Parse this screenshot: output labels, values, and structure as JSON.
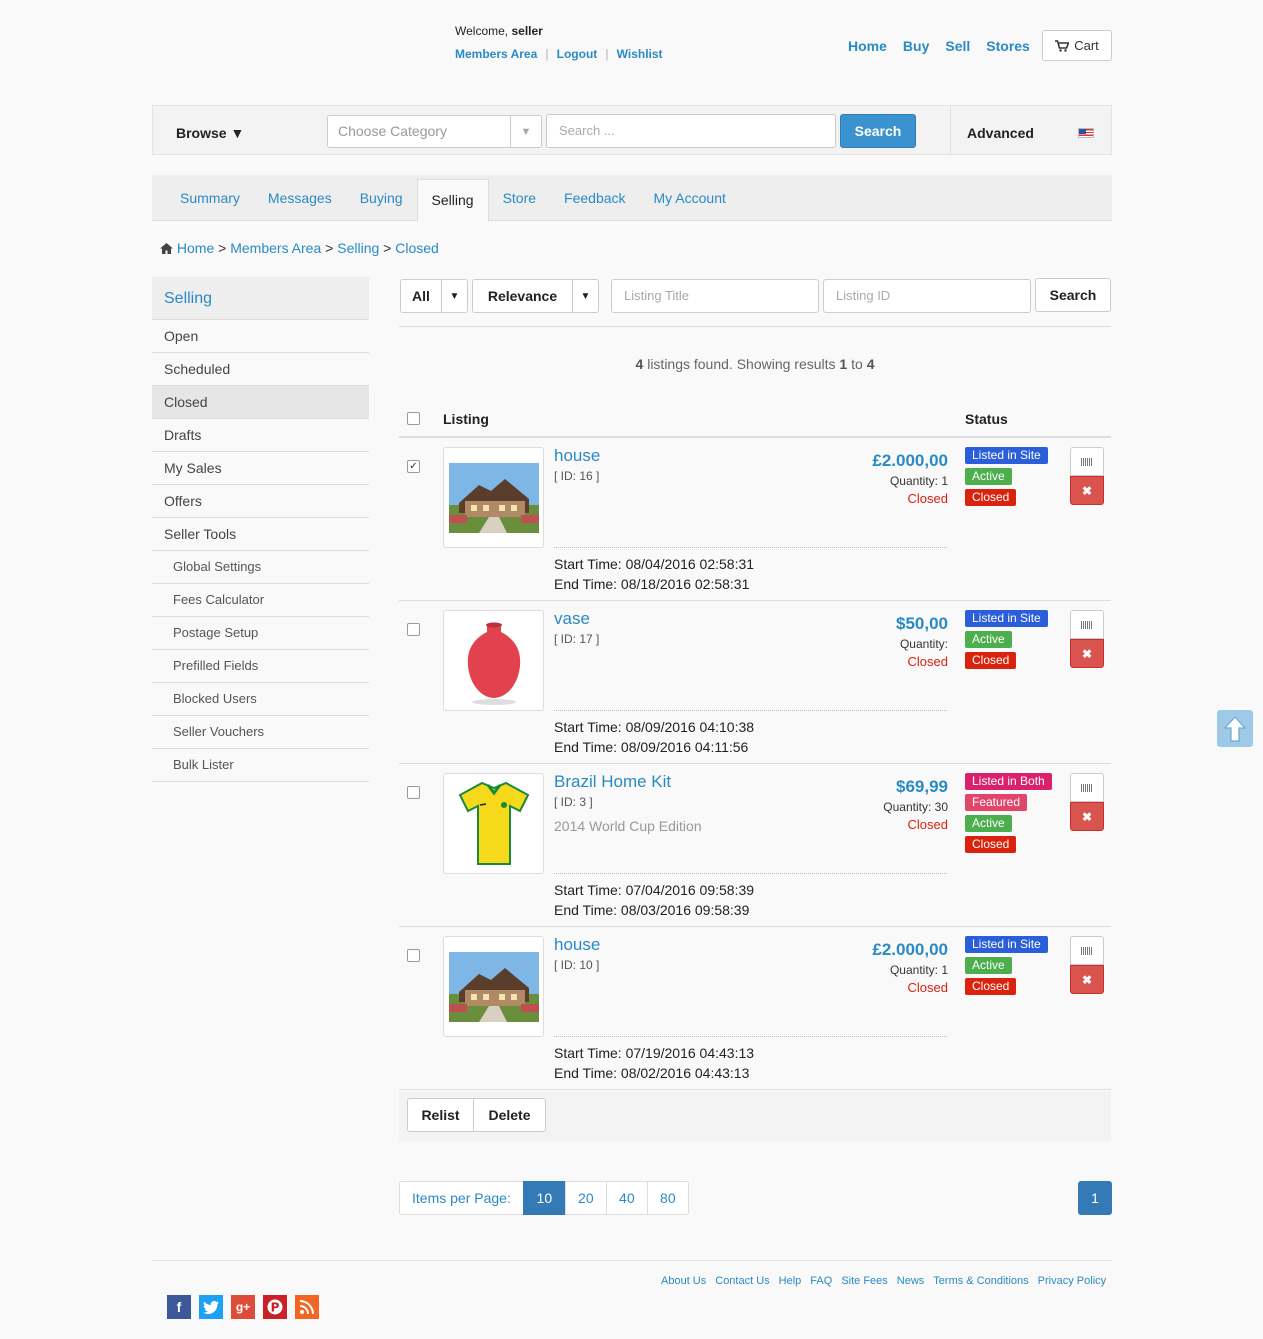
{
  "header": {
    "welcome_prefix": "Welcome,",
    "username": "seller",
    "links": [
      "Members Area",
      "Logout",
      "Wishlist"
    ],
    "nav": [
      "Home",
      "Buy",
      "Sell",
      "Stores"
    ],
    "cart_label": "Cart"
  },
  "searchbar": {
    "browse_label": "Browse ▼",
    "category_placeholder": "Choose Category",
    "search_placeholder": "Search ...",
    "search_button": "Search",
    "advanced_label": "Advanced"
  },
  "tabs": [
    "Summary",
    "Messages",
    "Buying",
    "Selling",
    "Store",
    "Feedback",
    "My Account"
  ],
  "active_tab": "Selling",
  "breadcrumb": [
    "Home",
    "Members Area",
    "Selling",
    "Closed"
  ],
  "sidebar": {
    "title": "Selling",
    "items": [
      "Open",
      "Scheduled",
      "Closed",
      "Drafts",
      "My Sales",
      "Offers",
      "Seller Tools"
    ],
    "sub_items": [
      "Global Settings",
      "Fees Calculator",
      "Postage Setup",
      "Prefilled Fields",
      "Blocked Users",
      "Seller Vouchers",
      "Bulk Lister"
    ],
    "active": "Closed"
  },
  "filters": {
    "filter_label": "All",
    "sort_label": "Relevance",
    "title_placeholder": "Listing Title",
    "id_placeholder": "Listing ID",
    "search_button": "Search"
  },
  "results": {
    "count": "4",
    "text_a": "listings found. Showing results",
    "from": "1",
    "to_word": "to",
    "to": "4"
  },
  "table": {
    "col_listing": "Listing",
    "col_status": "Status"
  },
  "listings": [
    {
      "title": "house",
      "id": "[ ID: 16 ]",
      "subtitle": "",
      "price": "£2.000,00",
      "quantity": "Quantity: 1",
      "state": "Closed",
      "start": "Start Time: 08/04/2016 02:58:31",
      "end": "End Time: 08/18/2016 02:58:31",
      "badges": [
        "Listed in Site",
        "Active",
        "Closed"
      ],
      "checked": true,
      "image": "house"
    },
    {
      "title": "vase",
      "id": "[ ID: 17 ]",
      "subtitle": "",
      "price": "$50,00",
      "quantity": "Quantity:",
      "state": "Closed",
      "start": "Start Time: 08/09/2016 04:10:38",
      "end": "End Time: 08/09/2016 04:11:56",
      "badges": [
        "Listed in Site",
        "Active",
        "Closed"
      ],
      "checked": false,
      "image": "vase"
    },
    {
      "title": "Brazil Home Kit",
      "id": "[ ID: 3 ]",
      "subtitle": "2014 World Cup Edition",
      "price": "$69,99",
      "quantity": "Quantity: 30",
      "state": "Closed",
      "start": "Start Time: 07/04/2016 09:58:39",
      "end": "End Time: 08/03/2016 09:58:39",
      "badges": [
        "Listed in Both",
        "Featured",
        "Active",
        "Closed"
      ],
      "checked": false,
      "image": "shirt"
    },
    {
      "title": "house",
      "id": "[ ID: 10 ]",
      "subtitle": "",
      "price": "£2.000,00",
      "quantity": "Quantity: 1",
      "state": "Closed",
      "start": "Start Time: 07/19/2016 04:43:13",
      "end": "End Time: 08/02/2016 04:43:13",
      "badges": [
        "Listed in Site",
        "Active",
        "Closed"
      ],
      "checked": false,
      "image": "house"
    }
  ],
  "bulk_actions": [
    "Relist",
    "Delete"
  ],
  "pagination": {
    "items_label": "Items per Page:",
    "sizes": [
      "10",
      "20",
      "40",
      "80"
    ],
    "active_size": "10",
    "current_page": "1"
  },
  "footer": {
    "links": [
      "About Us",
      "Contact Us",
      "Help",
      "FAQ",
      "Site Fees",
      "News",
      "Terms & Conditions",
      "Privacy Policy"
    ],
    "social": [
      "facebook-icon",
      "twitter-icon",
      "google-plus-icon",
      "pinterest-icon",
      "rss-icon"
    ]
  },
  "colors": {
    "link": "#2a8ac4",
    "primary_button": "#3a93cf",
    "listed_in_site": "#2a5fd9",
    "active": "#4cae4c",
    "closed": "#d9230f",
    "listed_in_both": "#d9226b"
  }
}
